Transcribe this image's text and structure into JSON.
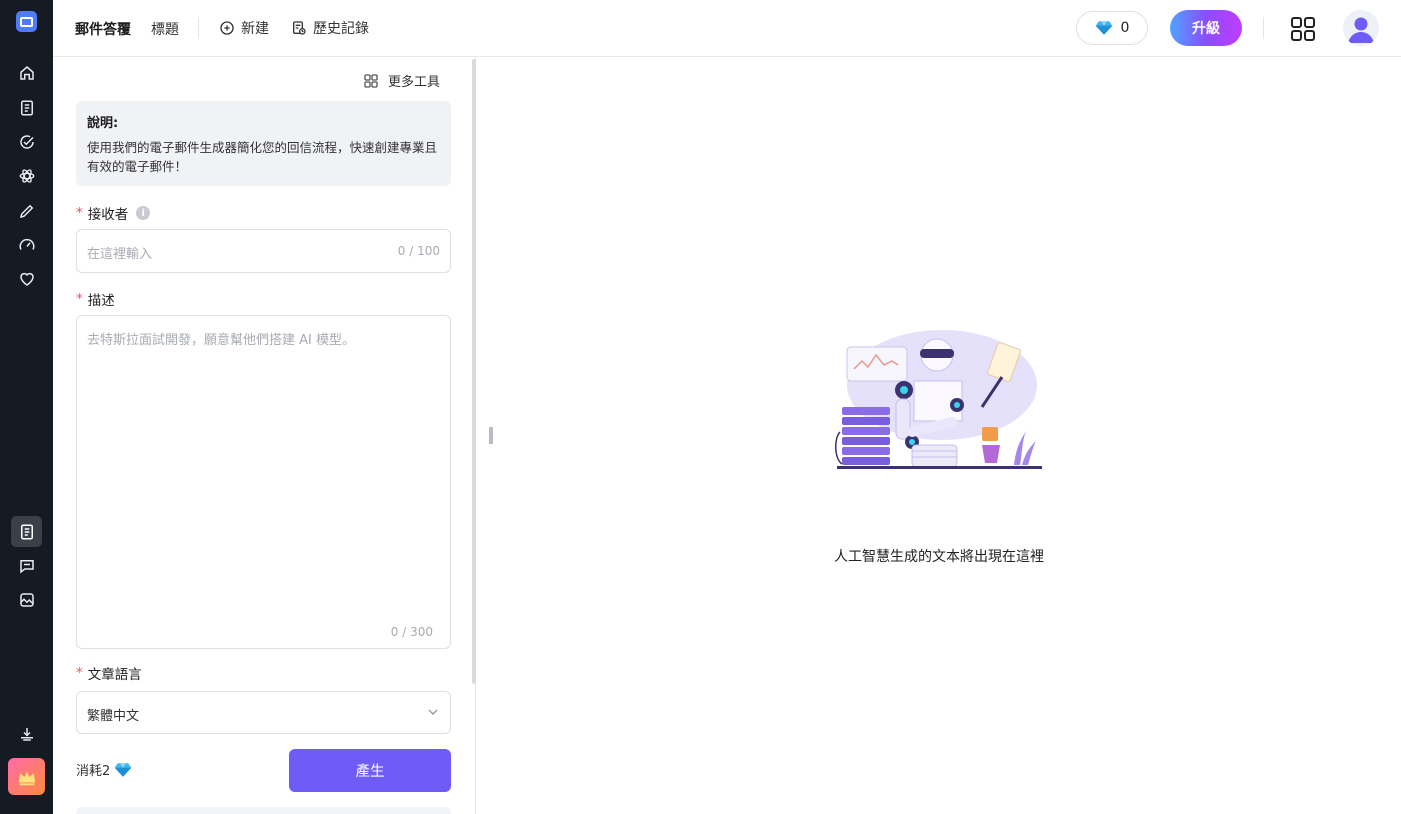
{
  "topbar": {
    "title": "郵件答覆",
    "subtitle": "標題",
    "new_label": "新建",
    "history_label": "歷史記錄",
    "gem_count": "0",
    "upgrade_label": "升級"
  },
  "panel": {
    "more_tools": "更多工具",
    "description_title": "說明:",
    "description_text": "使用我們的電子郵件生成器簡化您的回信流程，快速創建專業且有效的電子郵件！",
    "recipient": {
      "label": "接收者",
      "required_mark": "*",
      "placeholder": "在這裡輸入",
      "counter": "0 / 100"
    },
    "description_field": {
      "label": "描述",
      "required_mark": "*",
      "placeholder": "去特斯拉面試開發，願意幫他們搭建 AI 模型。",
      "counter": "0 / 300"
    },
    "language": {
      "label": "文章語言",
      "required_mark": "*",
      "selected": "繁體中文"
    },
    "cost_label": "消耗2",
    "generate_label": "產生"
  },
  "output": {
    "placeholder_text": "人工智慧生成的文本將出現在這裡"
  },
  "colors": {
    "accent": "#6f5bf5",
    "rail_bg": "#161a23",
    "required": "#ff4d4f"
  },
  "icons": {
    "rail": [
      "home-icon",
      "document-icon",
      "check-circle-icon",
      "atom-icon",
      "pencil-icon",
      "gauge-icon",
      "heart-icon",
      "notes-icon",
      "chat-icon",
      "image-icon",
      "download-icon",
      "crown-icon"
    ]
  }
}
